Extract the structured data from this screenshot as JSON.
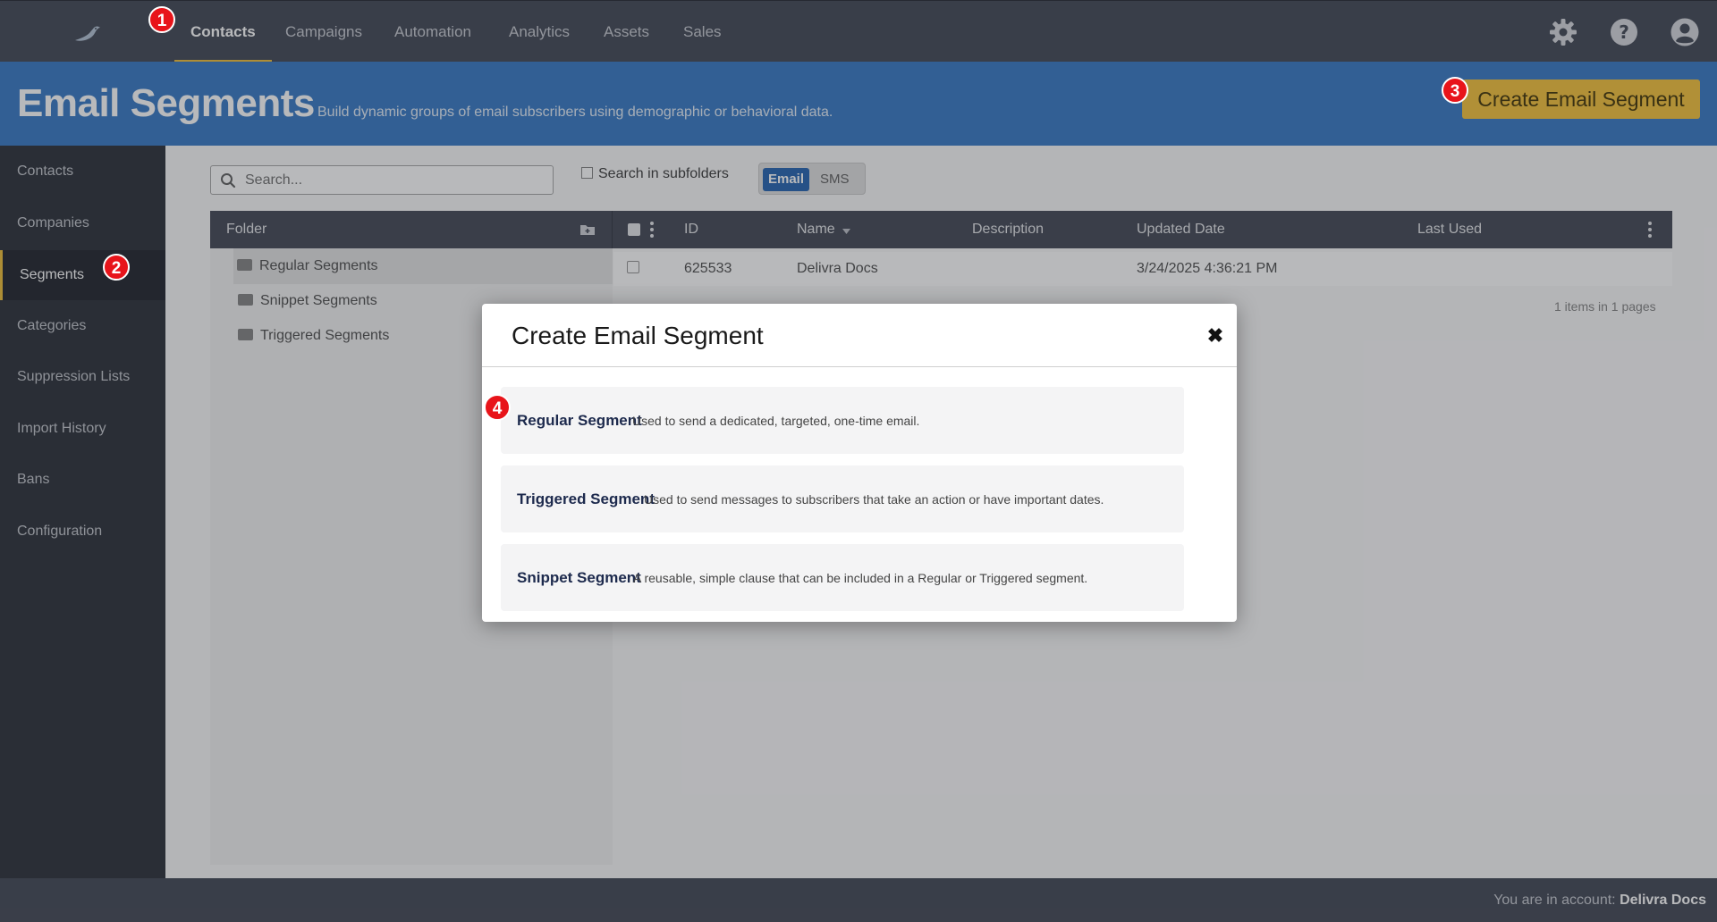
{
  "nav": {
    "items": [
      {
        "label": "Contacts",
        "active": true
      },
      {
        "label": "Campaigns"
      },
      {
        "label": "Automation"
      },
      {
        "label": "Analytics"
      },
      {
        "label": "Assets"
      },
      {
        "label": "Sales"
      }
    ],
    "icons": [
      "gear-icon",
      "help-icon",
      "user-icon"
    ]
  },
  "header": {
    "title": "Email Segments",
    "subtitle": "Build dynamic groups of email subscribers using demographic or behavioral data.",
    "create_button": "Create Email Segment"
  },
  "sidebar": {
    "items": [
      {
        "label": "Contacts"
      },
      {
        "label": "Companies"
      },
      {
        "label": "Segments",
        "active": true
      },
      {
        "label": "Categories"
      },
      {
        "label": "Suppression Lists"
      },
      {
        "label": "Import History"
      },
      {
        "label": "Bans"
      },
      {
        "label": "Configuration"
      }
    ]
  },
  "search": {
    "placeholder": "Search..."
  },
  "subfolders_label": "Search in subfolders",
  "channel_toggle": {
    "email": "Email",
    "sms": "SMS"
  },
  "table": {
    "folder_header": "Folder",
    "columns": [
      "ID",
      "Name",
      "Description",
      "Updated Date",
      "Last Used"
    ],
    "folders": [
      "Regular Segments",
      "Snippet Segments",
      "Triggered Segments"
    ],
    "rows": [
      {
        "id": "625533",
        "name": "Delivra Docs",
        "description": "",
        "updated": "3/24/2025 4:36:21 PM",
        "last_used": ""
      }
    ],
    "pager": "1 items in 1 pages"
  },
  "footer": {
    "prefix": "You are in account:",
    "account": "Delivra Docs"
  },
  "modal": {
    "title": "Create Email Segment",
    "options": [
      {
        "title": "Regular Segment",
        "desc": "Used to send a dedicated, targeted, one-time email."
      },
      {
        "title": "Triggered Segment",
        "desc": "Used to send messages to subscribers that take an action or have important dates."
      },
      {
        "title": "Snippet Segment",
        "desc": "A reusable, simple clause that can be included in a Regular or Triggered segment."
      }
    ]
  },
  "markers": [
    "1",
    "2",
    "3",
    "4"
  ],
  "colors": {
    "accent": "#f5c542",
    "brand_blue": "#3f7fc8",
    "marker_red": "#e8141a"
  }
}
